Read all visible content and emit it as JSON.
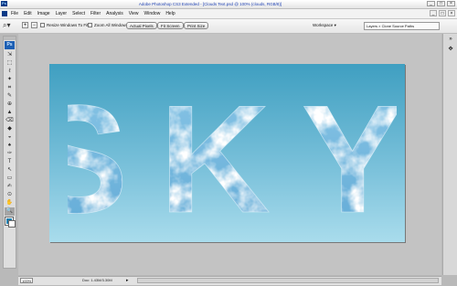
{
  "window": {
    "title": "Adobe Photoshop CS3 Extended - [Clouds Text.psd @ 100% (clouds, RGB/8)]",
    "app_icon_text": "Ps",
    "buttons": [
      "_",
      "□",
      "×"
    ]
  },
  "menu": {
    "items": [
      "File",
      "Edit",
      "Image",
      "Layer",
      "Select",
      "Filter",
      "Analysis",
      "View",
      "Window",
      "Help"
    ],
    "right_buttons": [
      "_",
      "□",
      "×"
    ]
  },
  "options": {
    "zoom_tool_icon": "zoom-icon",
    "zoom_in": "+",
    "zoom_out": "−",
    "resize_windows_label": "Resize Windows To Fit",
    "zoom_all_windows_label": "Zoom All Windows",
    "actual_pixels_label": "Actual Pixels",
    "fit_screen_label": "Fit Screen",
    "print_size_label": "Print Size",
    "workspace_label": "Workspace ▾",
    "panel_tabs": "Layers × Clone Source  Paths"
  },
  "toolbox": {
    "logo": "Ps",
    "tools": [
      "⇲",
      "⬚",
      "ℓ",
      "✦",
      "⌗",
      "✎",
      "⊕",
      "▲",
      "⌫",
      "◆",
      "◒",
      "♠",
      "✑",
      "T",
      "↖",
      "▭",
      "✍",
      "⊙",
      "✋",
      "🔍"
    ]
  },
  "canvas": {
    "text": "SKY",
    "colors": {
      "sky_top": "#3f9fc1",
      "sky_bottom": "#a9dcec",
      "cloud_white": "#ffffff",
      "cloud_blue": "#6fb4dd"
    }
  },
  "status": {
    "zoom": "100%",
    "doc": "Doc: 1.43M/3.30M",
    "arrow": "▸"
  },
  "colors": {
    "foreground": "#1f7fae",
    "background": "#ffffff"
  }
}
